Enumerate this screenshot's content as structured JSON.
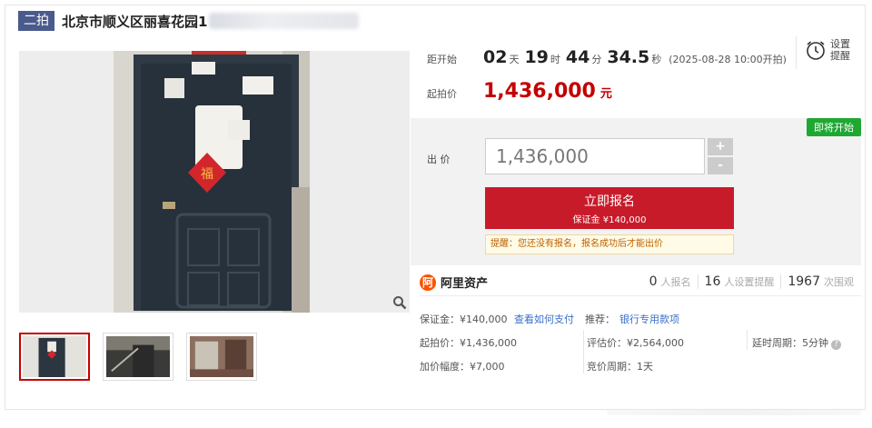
{
  "header": {
    "round_tag": "二拍",
    "title": "北京市顺义区丽喜花园1"
  },
  "countdown": {
    "label": "距开始",
    "days": "02",
    "days_unit": "天",
    "hours": "19",
    "hours_unit": "时",
    "minutes": "44",
    "minutes_unit": "分",
    "seconds": "34.5",
    "seconds_unit": "秒",
    "start_note": "(2025-08-28 10:00开拍)"
  },
  "remind": {
    "line1": "设置",
    "line2": "提醒"
  },
  "starting_price": {
    "label": "起拍价",
    "value": "1,436,000",
    "unit": "元"
  },
  "bid": {
    "badge": "即将开始",
    "label": "出 价",
    "input_value": "1,436,000",
    "plus": "+",
    "minus": "-",
    "signup_label": "立即报名",
    "signup_sub": "保证金 ¥140,000",
    "tip": "提醒：您还没有报名，报名成功后才能出价"
  },
  "brand": {
    "logo_glyph": "阿",
    "name": "阿里资产",
    "stats": [
      {
        "num": "0",
        "label": "人报名"
      },
      {
        "num": "16",
        "label": "人设置提醒"
      },
      {
        "num": "1967",
        "label": "次围观"
      }
    ]
  },
  "details": {
    "deposit": "保证金：¥140,000",
    "how_to_pay": "查看如何支付",
    "recommend_label": "推荐：",
    "recommend_link": "银行专用款项",
    "start_price": "起拍价：¥1,436,000",
    "appraisal": "评估价：¥2,564,000",
    "delay": "延时周期：5分钟",
    "increment": "加价幅度：¥7,000",
    "cycle": "竞价周期：1天"
  },
  "colors": {
    "accent_red": "#c40000",
    "button_red": "#c81b2a",
    "tag_blue": "#4b5a8c",
    "badge_green": "#1ea832",
    "link_blue": "#3b6fc6"
  },
  "icons": {
    "zoom": "magnifier-icon",
    "clock": "alarm-clock-icon",
    "help": "question-circle-icon"
  }
}
